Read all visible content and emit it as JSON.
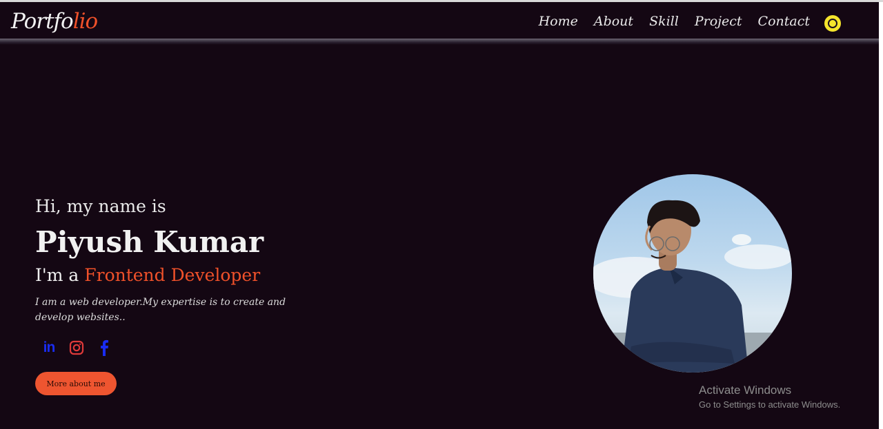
{
  "header": {
    "logo_main": "Portfo",
    "logo_accent": "lio",
    "nav": [
      "Home",
      "About",
      "Skill",
      "Project",
      "Contact"
    ],
    "theme_toggle_icon": "sun-icon"
  },
  "hero": {
    "greeting": "Hi, my name is",
    "name": "Piyush Kumar",
    "role_prefix": "I'm a",
    "role_highlight": "Frontend Developer",
    "description": "I am a web developer.My expertise is to create and develop websites..",
    "socials": [
      {
        "icon": "linkedin-icon",
        "label": "in",
        "color": "#1a2cf0"
      },
      {
        "icon": "instagram-icon",
        "color": "#e03a3a"
      },
      {
        "icon": "facebook-icon",
        "color": "#1a2cf0"
      }
    ],
    "cta_label": "More about me"
  },
  "watermark": {
    "title": "Activate Windows",
    "subtitle": "Go to Settings to activate Windows."
  },
  "colors": {
    "background": "#140713",
    "accent": "#f0512a",
    "button": "#ee5530",
    "toggle": "#f5e52c"
  }
}
